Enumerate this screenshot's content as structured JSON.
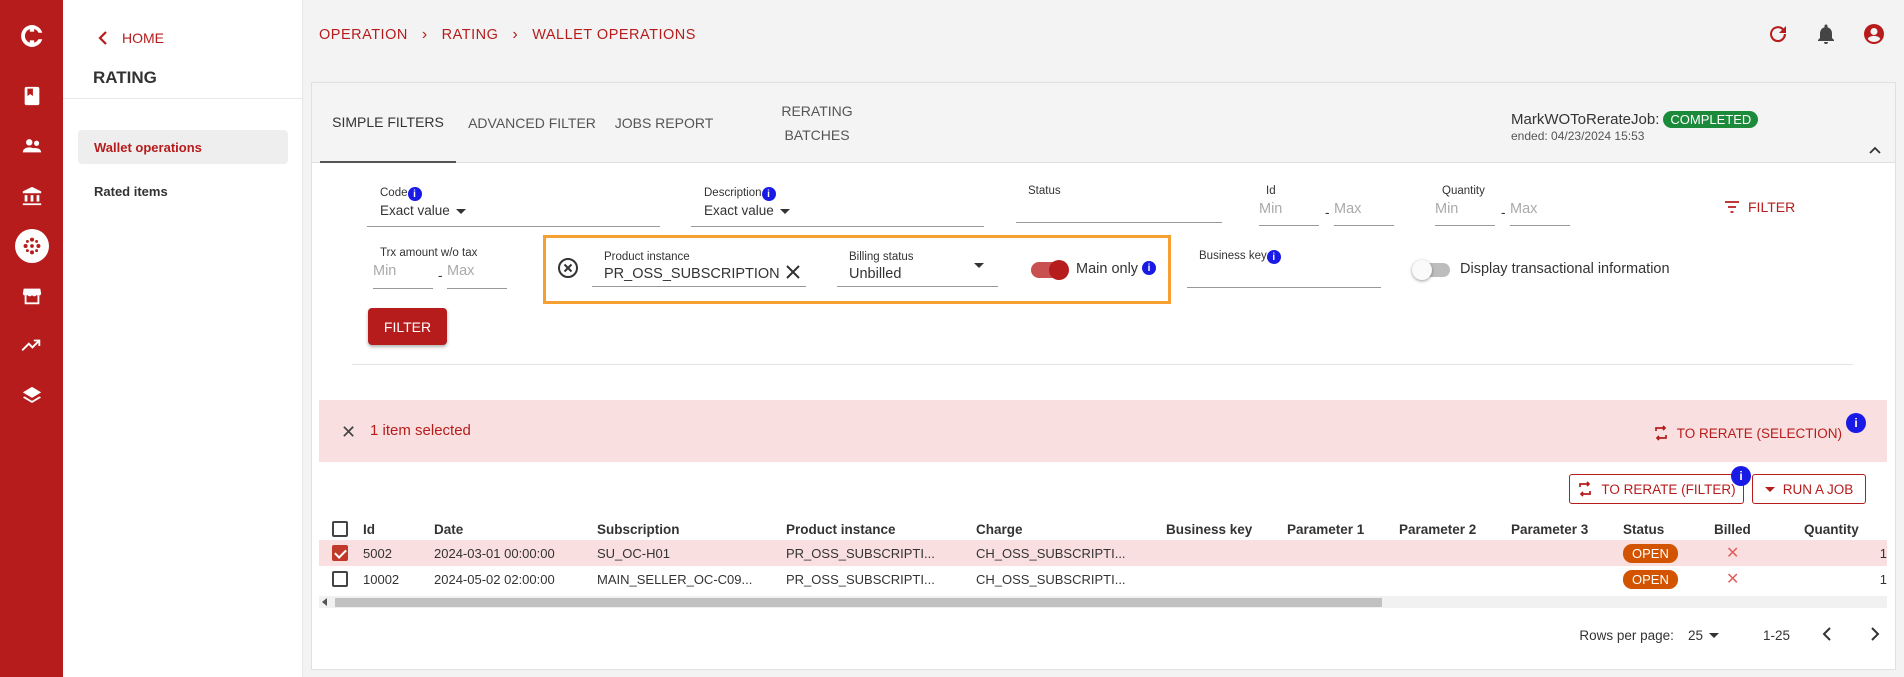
{
  "breadcrumb": [
    "OPERATION",
    "RATING",
    "WALLET OPERATIONS"
  ],
  "side": {
    "home": "HOME",
    "section": "RATING",
    "items": [
      {
        "label": "Wallet operations",
        "selected": true
      },
      {
        "label": "Rated items",
        "selected": false
      }
    ]
  },
  "rail_icons": [
    "logo-icon",
    "book-icon",
    "people-icon",
    "bank-icon",
    "rating-icon",
    "store-icon",
    "trending-up-icon",
    "layers-icon"
  ],
  "tabs": [
    "SIMPLE FILTERS",
    "ADVANCED FILTER",
    "JOBS REPORT",
    "RERATING",
    "BATCHES"
  ],
  "job": {
    "name": "MarkWOToRerateJob:",
    "status": "COMPLETED",
    "ended": "ended: 04/23/2024 15:53"
  },
  "filters": {
    "code_label": "Code",
    "code_value": "Exact value",
    "description_label": "Description",
    "description_value": "Exact value",
    "status_label": "Status",
    "id_label": "Id",
    "quantity_label": "Quantity",
    "min": "Min",
    "max": "Max",
    "dash": "-",
    "filter_link": "FILTER",
    "trx_label": "Trx amount w/o tax",
    "product_instance_label": "Product instance",
    "product_instance_value": "PR_OSS_SUBSCRIPTION",
    "billing_status_label": "Billing status",
    "billing_status_value": "Unbilled",
    "main_only": "Main only",
    "business_key_label": "Business key",
    "display_trx": "Display transactional information",
    "filter_button": "FILTER",
    "info": "i"
  },
  "selection": {
    "text": "1 item selected",
    "to_rerate_selection": "TO RERATE (SELECTION)",
    "to_rerate_filter": "TO RERATE (FILTER)",
    "run_job": "RUN A JOB"
  },
  "table": {
    "columns": [
      "Id",
      "Date",
      "Subscription",
      "Product instance",
      "Charge",
      "Business key",
      "Parameter 1",
      "Parameter 2",
      "Parameter 3",
      "Status",
      "Billed",
      "Quantity"
    ],
    "rows": [
      {
        "selected": true,
        "id": "5002",
        "date": "2024-03-01 00:00:00",
        "subscription": "SU_OC-H01",
        "product_instance": "PR_OSS_SUBSCRIPTI...",
        "charge": "CH_OSS_SUBSCRIPTI...",
        "status": "OPEN",
        "billed": "✕",
        "quantity": "1"
      },
      {
        "selected": false,
        "id": "10002",
        "date": "2024-05-02 02:00:00",
        "subscription": "MAIN_SELLER_OC-C09...",
        "product_instance": "PR_OSS_SUBSCRIPTI...",
        "charge": "CH_OSS_SUBSCRIPTI...",
        "status": "OPEN",
        "billed": "✕",
        "quantity": "1"
      }
    ]
  },
  "pager": {
    "rows_per_page_label": "Rows per page:",
    "rows_per_page": "25",
    "range": "1-25"
  },
  "colors": {
    "brand": "#b71c1c",
    "selected_row": "#f9dfdf",
    "completed": "#1b8a3a",
    "open": "#d35400",
    "highlight_box": "#f5a031"
  }
}
